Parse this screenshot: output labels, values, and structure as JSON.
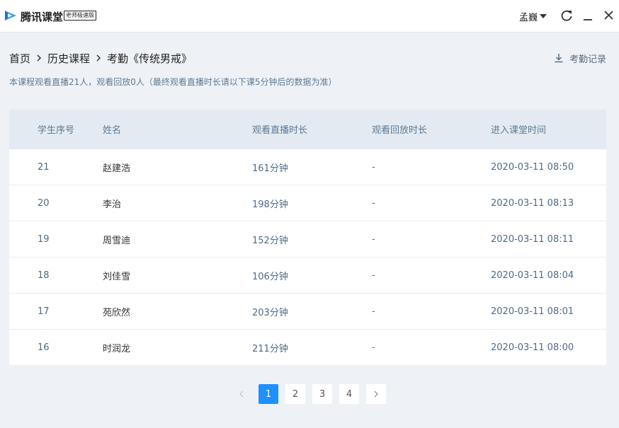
{
  "app": {
    "name": "腾讯课堂",
    "edition": "老师极速版",
    "user": "孟巍"
  },
  "breadcrumb": {
    "home": "首页",
    "history": "历史课程",
    "current": "考勤《传统男戒》"
  },
  "attendance_record": "考勤记录",
  "summary": "本课程观看直播21人，观看回放0人（最终观看直播时长请以下课5分钟后的数据为准）",
  "table": {
    "headers": [
      "学生序号",
      "姓名",
      "观看直播时长",
      "观看回放时长",
      "进入课堂时间"
    ],
    "rows": [
      {
        "seq": "21",
        "name": "赵建浩",
        "live": "161分钟",
        "replay": "-",
        "time": "2020-03-11 08:50"
      },
      {
        "seq": "20",
        "name": "李治",
        "live": "198分钟",
        "replay": "-",
        "time": "2020-03-11 08:13"
      },
      {
        "seq": "19",
        "name": "周雪迪",
        "live": "152分钟",
        "replay": "-",
        "time": "2020-03-11 08:11"
      },
      {
        "seq": "18",
        "name": "刘佳雪",
        "live": "106分钟",
        "replay": "-",
        "time": "2020-03-11 08:04"
      },
      {
        "seq": "17",
        "name": "苑欣然",
        "live": "203分钟",
        "replay": "-",
        "time": "2020-03-11 08:01"
      },
      {
        "seq": "16",
        "name": "时润龙",
        "live": "211分钟",
        "replay": "-",
        "time": "2020-03-11 08:00"
      }
    ]
  },
  "pagination": {
    "pages": [
      "1",
      "2",
      "3",
      "4"
    ],
    "current": "1"
  },
  "colors": {
    "accent": "#1e90ff",
    "header_bg": "#e3eaf1",
    "page_bg": "#eef2f6"
  },
  "icons": {
    "logo": "tencent-classroom-logo",
    "caret": "caret-down-icon",
    "refresh": "refresh-icon",
    "minimize": "minimize-icon",
    "close": "close-icon",
    "separator": "chevron-right-icon",
    "download": "download-icon"
  }
}
